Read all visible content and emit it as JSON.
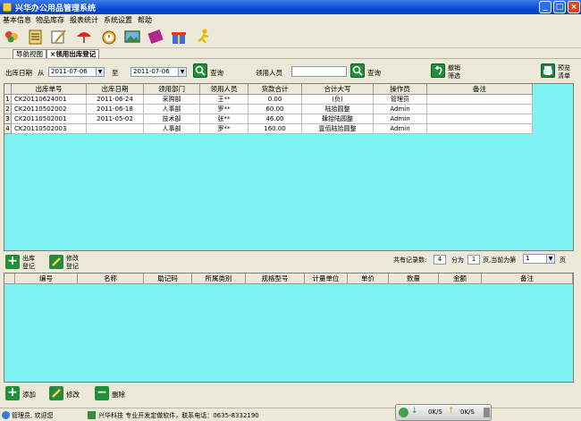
{
  "window": {
    "title": "兴华办公用品管理系统"
  },
  "menu": [
    "基本信息",
    "物品库存",
    "报表统计",
    "系统设置",
    "帮助"
  ],
  "toolbar_icons": [
    "user-group-icon",
    "notebook-icon",
    "edit-form-icon",
    "umbrella-icon",
    "alarm-clock-icon",
    "picture-icon",
    "book-icon",
    "gift-icon",
    "runner-icon"
  ],
  "tabs": {
    "nav": "导航视图",
    "current": "领用出库登记"
  },
  "query": {
    "date_label": "出库日期",
    "from_label": "从",
    "from_date": "2011-07-06",
    "to_label": "至",
    "to_date": "2011-07-06",
    "query1": "查询",
    "user_label": "领用人员",
    "user_value": "",
    "query2": "查询",
    "cancel_filter_line1": "撤销",
    "cancel_filter_line2": "筛选",
    "preview_line1": "预览",
    "preview_line2": "清单"
  },
  "grid1": {
    "headers": [
      "出库单号",
      "出库日期",
      "领用部门",
      "领用人员",
      "货款合计",
      "合计大写",
      "操作员",
      "备注"
    ],
    "rows": [
      {
        "num": "1",
        "id": "CK20110624001",
        "date": "2011-06-24",
        "dept": "采购部",
        "person": "王**",
        "total": "0.00",
        "upper": "(负)",
        "operator": "管理员",
        "note": ""
      },
      {
        "num": "2",
        "id": "CK20110502002",
        "date": "2011-06-18",
        "dept": "人事部",
        "person": "罗**",
        "total": "60.00",
        "upper": "陆拾圆整",
        "operator": "Admin",
        "note": ""
      },
      {
        "num": "3",
        "id": "CK20110502001",
        "date": "2011-05-02",
        "dept": "技术部",
        "person": "张**",
        "total": "46.00",
        "upper": "肆拾陆圆整",
        "operator": "Admin",
        "note": ""
      },
      {
        "num": "4",
        "id": "CK20110502003",
        "date": "",
        "dept": "人事部",
        "person": "罗**",
        "total": "160.00",
        "upper": "壹佰陆拾圆整",
        "operator": "Admin",
        "note": ""
      }
    ]
  },
  "actions": {
    "register_line1": "出库",
    "register_line2": "登记",
    "modify_line1": "修改",
    "modify_line2": "登记"
  },
  "pager": {
    "total_label": "共有记录数:",
    "total": "4",
    "pages_label": "分为",
    "pages": "1",
    "current_label": "页,当前为第",
    "current": "1",
    "page_suffix": "页"
  },
  "grid2": {
    "headers": [
      "编号",
      "名称",
      "助记码",
      "所属类别",
      "规格型号",
      "计量单位",
      "单价",
      "数量",
      "金额",
      "备注"
    ]
  },
  "bottom_actions": {
    "add": "添加",
    "modify": "修改",
    "delete": "删除"
  },
  "status": {
    "user": "管理员, 欢迎您",
    "company": "兴华科技 专业开发定做软件，联系电话：0635-8332190",
    "down_speed": "0K/S",
    "up_speed": "0K/S"
  }
}
